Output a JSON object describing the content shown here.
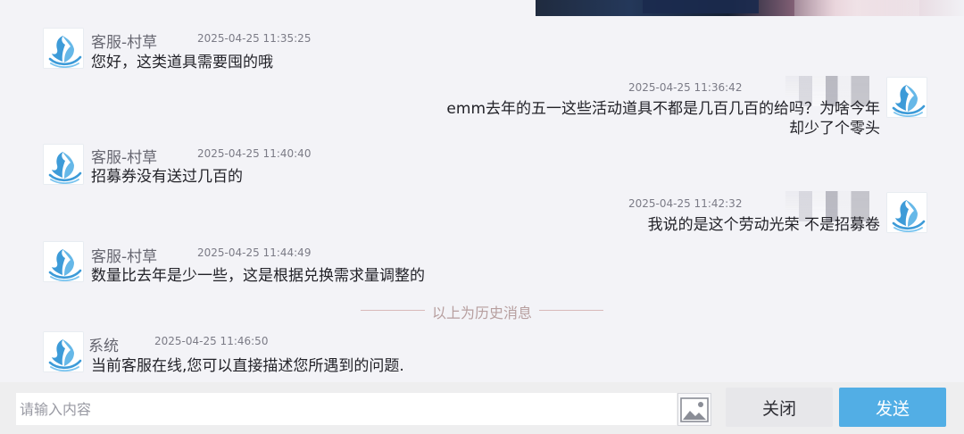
{
  "chat": {
    "messages": [
      {
        "sender": "客服-村草",
        "time": "2025-04-25 11:35:25",
        "text": "您好，这类道具需要囤的哦"
      },
      {
        "time": "2025-04-25 11:36:42",
        "text": "emm去年的五一这些活动道具不都是几百几百的给吗？为啥今年却少了个零头"
      },
      {
        "sender": "客服-村草",
        "time": "2025-04-25 11:40:40",
        "text": "招募券没有送过几百的"
      },
      {
        "time": "2025-04-25 11:42:32",
        "text": "我说的是这个劳动光荣 不是招募卷"
      },
      {
        "sender": "客服-村草",
        "time": "2025-04-25 11:44:49",
        "text": "数量比去年是少一些，这是根据兑换需求量调整的"
      },
      {
        "sender": "系统",
        "time": "2025-04-25 11:46:50",
        "text": "当前客服在线,您可以直接描述您所遇到的问题."
      }
    ],
    "history_divider": "以上为历史消息"
  },
  "input_bar": {
    "placeholder": "请输入内容",
    "close_label": "关闭",
    "send_label": "发送"
  },
  "icons": {
    "avatar": "whale-avatar-icon",
    "image": "image-upload-icon"
  },
  "colors": {
    "send_button": "#52aee5",
    "avatar_blue": "#3d9bd8"
  }
}
